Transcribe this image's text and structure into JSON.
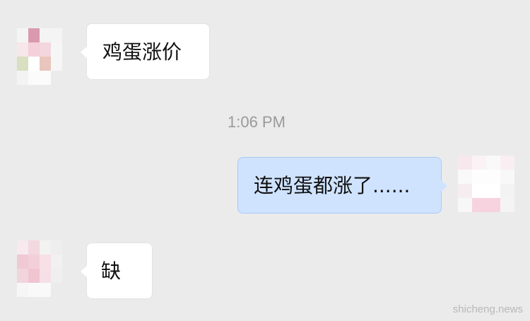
{
  "colors": {
    "background": "#ebebeb",
    "incoming_bubble": "#ffffff",
    "outgoing_bubble": "#cfe3ff",
    "timestamp_text": "#9a9a9a"
  },
  "messages": [
    {
      "direction": "incoming",
      "text": "鸡蛋涨价"
    },
    {
      "direction": "outgoing",
      "text": "连鸡蛋都涨了......"
    },
    {
      "direction": "incoming",
      "text": "缺"
    }
  ],
  "timestamp": "1:06 PM",
  "watermark": "shicheng.news"
}
